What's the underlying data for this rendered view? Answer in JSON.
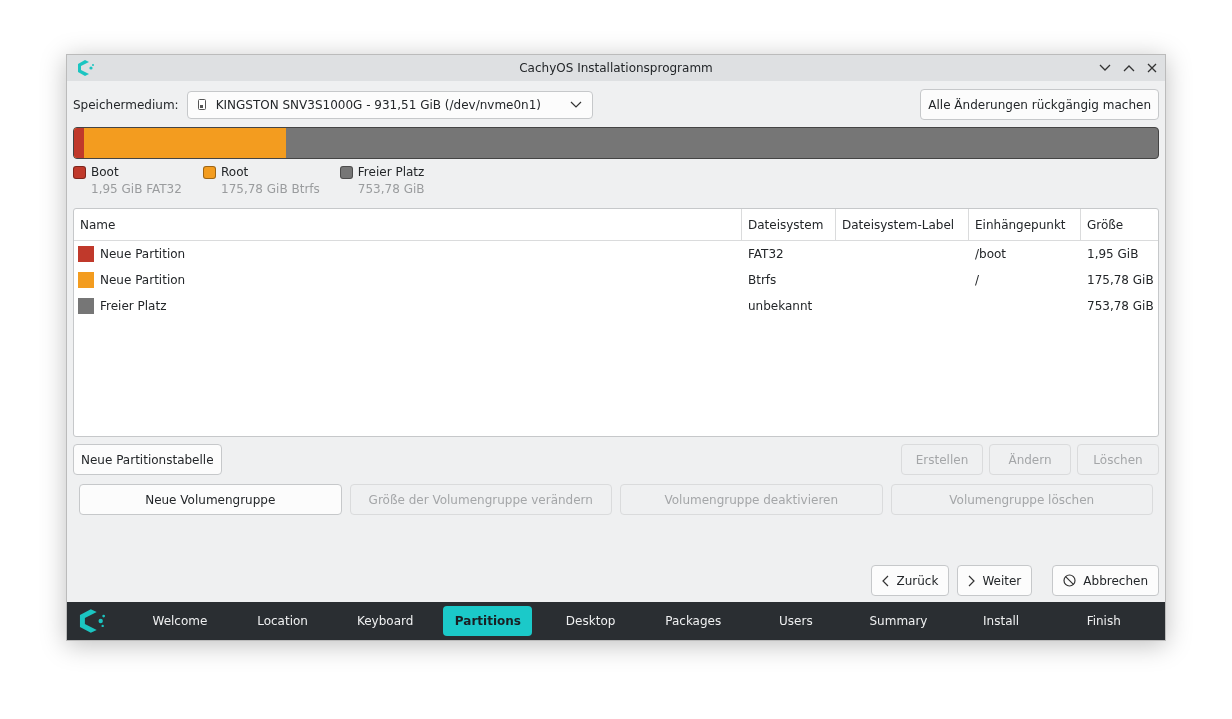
{
  "window": {
    "title": "CachyOS Installationsprogramm"
  },
  "device": {
    "label": "Speichermedium:",
    "value": "KINGSTON SNV3S1000G - 931,51 GiB (/dev/nvme0n1)"
  },
  "revert_button": {
    "label": "Alle Änderungen rückgängig machen"
  },
  "usage_bar": [
    {
      "color": "#c0392b",
      "level": 0.009
    },
    {
      "color": "#f39c1f",
      "level": 0.196
    },
    {
      "color": "#767676",
      "kind": "free"
    }
  ],
  "legend": [
    {
      "name": "Boot",
      "detail": "1,95 GiB FAT32",
      "color": "#c0392b"
    },
    {
      "name": "Root",
      "detail": "175,78 GiB Btrfs",
      "color": "#f39c1f"
    },
    {
      "name": "Freier Platz",
      "detail": "753,78 GiB",
      "color": "#767676"
    }
  ],
  "table": {
    "columns": [
      "Name",
      "Dateisystem",
      "Dateisystem-Label",
      "Einhängepunkt",
      "Größe"
    ],
    "rows": [
      {
        "color": "#c0392b",
        "name": "Neue Partition",
        "filesystem": "FAT32",
        "mount": "/boot",
        "size": "1,95 GiB"
      },
      {
        "color": "#f39c1f",
        "name": "Neue Partition",
        "filesystem": "Btrfs",
        "mount": "/",
        "size": "175,78 GiB"
      },
      {
        "color": "#767676",
        "name": "Freier Platz",
        "filesystem": "unbekannt",
        "mount": "",
        "size": "753,78 GiB"
      }
    ]
  },
  "partition_buttons": [
    {
      "label": "Neue Partitionstabelle",
      "disabled": false
    },
    {
      "label": "Erstellen",
      "disabled": true
    },
    {
      "label": "Ändern",
      "disabled": true
    },
    {
      "label": "Löschen",
      "disabled": true
    }
  ],
  "volume_buttons": [
    {
      "label": "Neue Volumengruppe",
      "disabled": false
    },
    {
      "label": "Größe der Volumengruppe verändern",
      "disabled": true
    },
    {
      "label": "Volumengruppe deaktivieren",
      "disabled": true
    },
    {
      "label": "Volumengruppe löschen",
      "disabled": true
    }
  ],
  "nav_buttons": [
    {
      "kind": "back",
      "label": "Zurück"
    },
    {
      "kind": "next",
      "label": "Weiter"
    },
    {
      "kind": "cancel",
      "label": "Abbrechen"
    }
  ],
  "steps": [
    {
      "label": "Welcome",
      "selected": false
    },
    {
      "label": "Location",
      "selected": false
    },
    {
      "label": "Keyboard",
      "selected": false
    },
    {
      "label": "Partitions",
      "selected": true
    },
    {
      "label": "Desktop",
      "selected": false
    },
    {
      "label": "Packages",
      "selected": false
    },
    {
      "label": "Users",
      "selected": false
    },
    {
      "label": "Summary",
      "selected": false
    },
    {
      "label": "Install",
      "selected": false
    },
    {
      "label": "Finish",
      "selected": false
    }
  ]
}
